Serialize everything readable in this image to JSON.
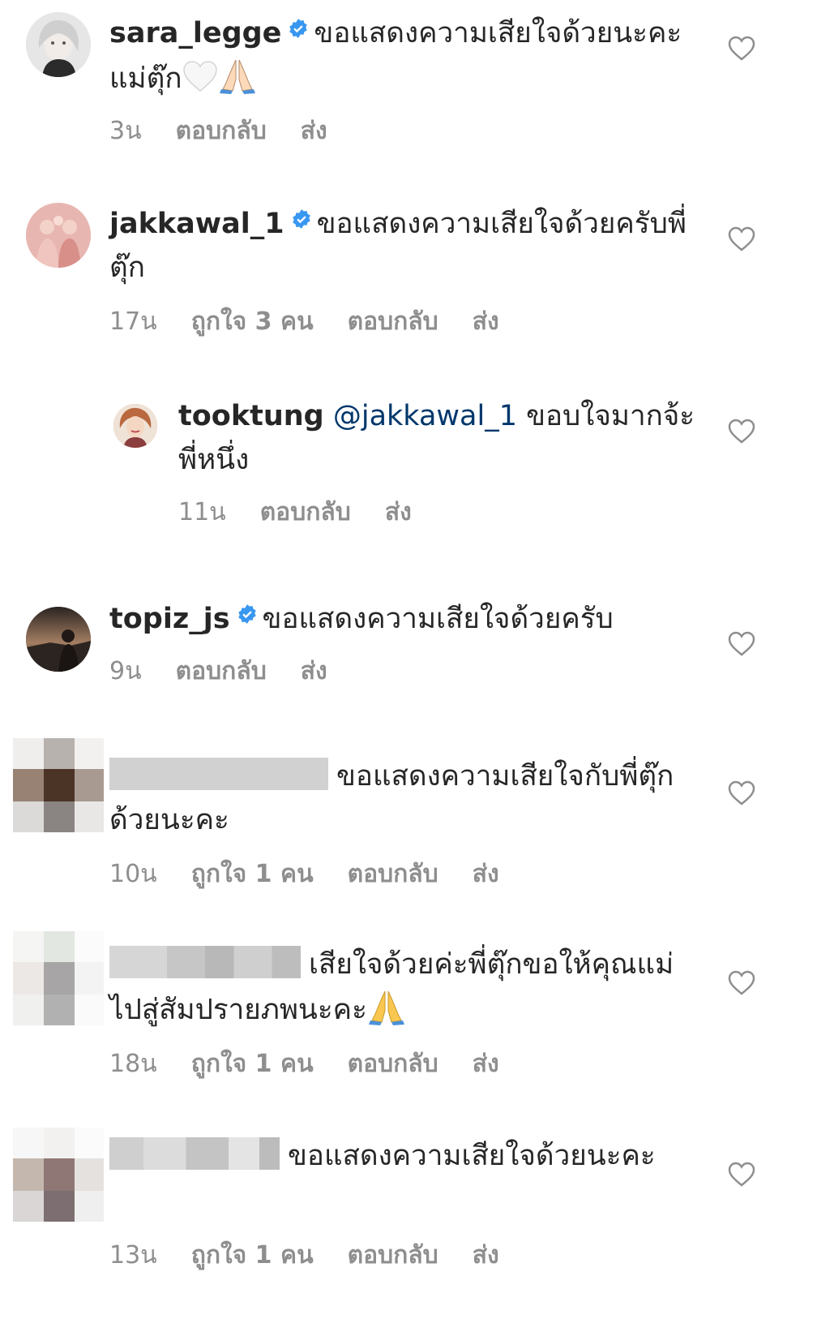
{
  "comments": [
    {
      "username": "sara_legge",
      "verified": true,
      "text": "ขอแสดงความเสียใจด้วยนะคะแม่ตุ๊ก",
      "time": "3น",
      "likes": "",
      "reply": "ตอบกลับ",
      "send": "ส่ง",
      "avatar_icon": "profile-photo"
    },
    {
      "username": "jakkawal_1",
      "verified": true,
      "text": "ขอแสดงความเสียใจด้วยครับพี่ตุ๊ก",
      "time": "17น",
      "likes": "ถูกใจ 3 คน",
      "reply": "ตอบกลับ",
      "send": "ส่ง",
      "avatar_icon": "profile-photo"
    },
    {
      "username": "tooktung",
      "verified": false,
      "mention": "@jakkawal_1",
      "text": "ขอบใจมากจ้ะพี่หนึ่ง",
      "time": "11น",
      "likes": "",
      "reply": "ตอบกลับ",
      "send": "ส่ง",
      "avatar_icon": "profile-photo"
    },
    {
      "username": "topiz_js",
      "verified": true,
      "text": "ขอแสดงความเสียใจด้วยครับ",
      "time": "9น",
      "likes": "",
      "reply": "ตอบกลับ",
      "send": "ส่ง",
      "avatar_icon": "profile-photo"
    },
    {
      "username": "",
      "text": "ขอแสดงความเสียใจกับพี่ตุ๊กด้วยนะคะ",
      "time": "10น",
      "likes": "ถูกใจ 1 คน",
      "reply": "ตอบกลับ",
      "send": "ส่ง",
      "avatar_icon": "pixelated-avatar"
    },
    {
      "username": "",
      "text": "เสียใจด้วยค่ะพี่ตุ๊กขอให้คุณแม่ไปสู่สัมปรายภพนะคะ",
      "time": "18น",
      "likes": "ถูกใจ 1 คน",
      "reply": "ตอบกลับ",
      "send": "ส่ง",
      "avatar_icon": "pixelated-avatar"
    },
    {
      "username": "",
      "text": "ขอแสดงความเสียใจด้วยนะคะ",
      "time": "13น",
      "likes": "ถูกใจ 1 คน",
      "reply": "ตอบกลับ",
      "send": "ส่ง",
      "avatar_icon": "pixelated-avatar"
    }
  ],
  "icons": {
    "like": "heart-outline-icon",
    "verified": "verified-badge-icon",
    "white_heart": "white-heart-emoji",
    "pray": "folded-hands-emoji"
  },
  "colors": {
    "text": "#262626",
    "secondary": "#8e8e8e",
    "verified": "#3897f0",
    "mention": "#00376b"
  }
}
